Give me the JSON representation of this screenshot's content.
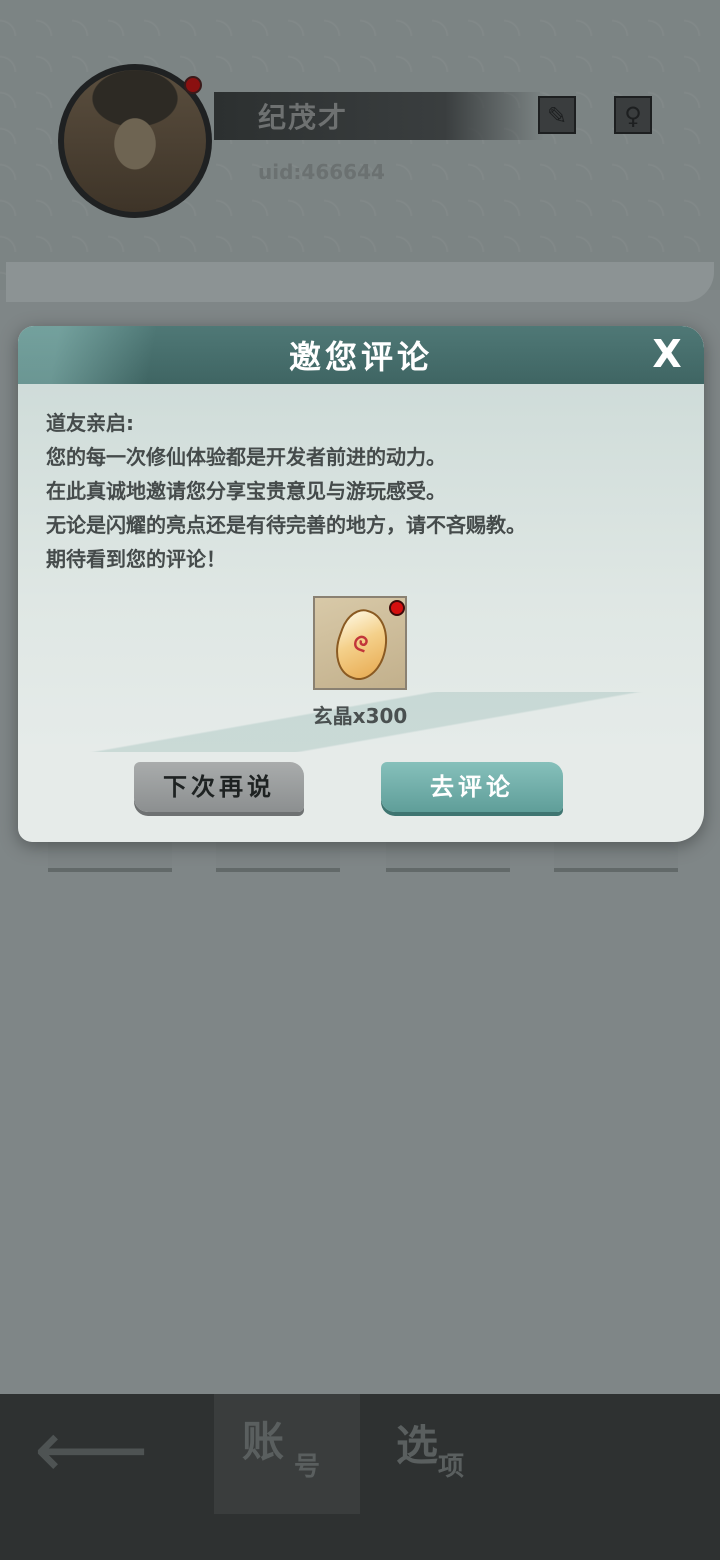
{
  "profile": {
    "name": "纪茂才",
    "uid": "uid:466644",
    "edit_icon": "brush-icon",
    "gender_icon": "female-icon"
  },
  "bottom_nav": {
    "back_icon": "back-arrow-icon",
    "tab_account": {
      "big": "账",
      "small": "号"
    },
    "tab_options": {
      "big": "选",
      "small": "项"
    }
  },
  "modal": {
    "title": "邀您评论",
    "close_label": "X",
    "message_lines": [
      "道友亲启:",
      "您的每一次修仙体验都是开发者前进的动力。",
      "在此真诚地邀请您分享宝贵意见与游玩感受。",
      "无论是闪耀的亮点还是有待完善的地方，请不吝赐教。",
      "期待看到您的评论！"
    ],
    "reward": {
      "icon": "crystal-icon",
      "label": "玄晶x300"
    },
    "buttons": {
      "later": "下次再说",
      "review": "去评论"
    }
  },
  "colors": {
    "header_teal": "#4f7876",
    "review_button": "#6fa8a3",
    "later_button": "#9a9d9e",
    "notification_dot": "#d40f0f"
  }
}
